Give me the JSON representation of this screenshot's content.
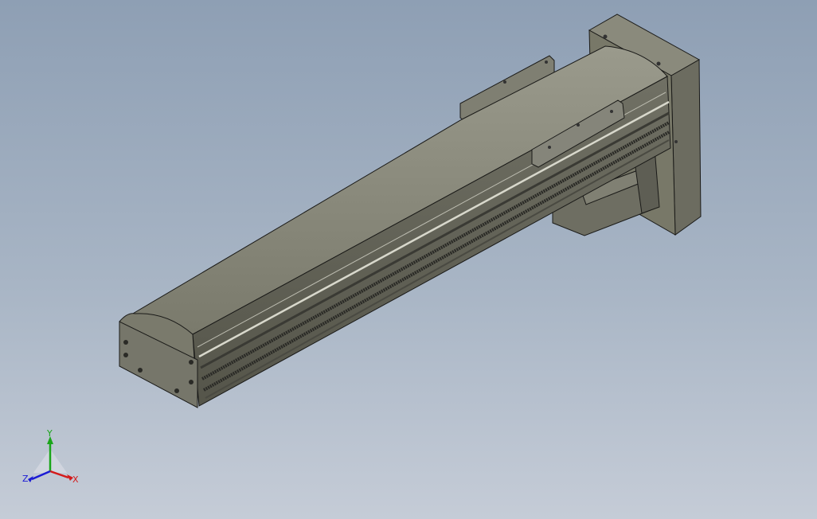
{
  "viewport": {
    "background_top": "#8e9fb4",
    "background_bottom": "#c5ccd7"
  },
  "model": {
    "name": "linear-actuator-module",
    "body_color": "#7b7b6e",
    "top_color": "#8d8d80",
    "face_color": "#6a6a5e",
    "edge_color": "#1a1a18"
  },
  "triad": {
    "x_label": "X",
    "y_label": "Y",
    "z_label": "Z",
    "x_color": "#d41a1a",
    "y_color": "#1aa51a",
    "z_color": "#1a1ad4"
  }
}
